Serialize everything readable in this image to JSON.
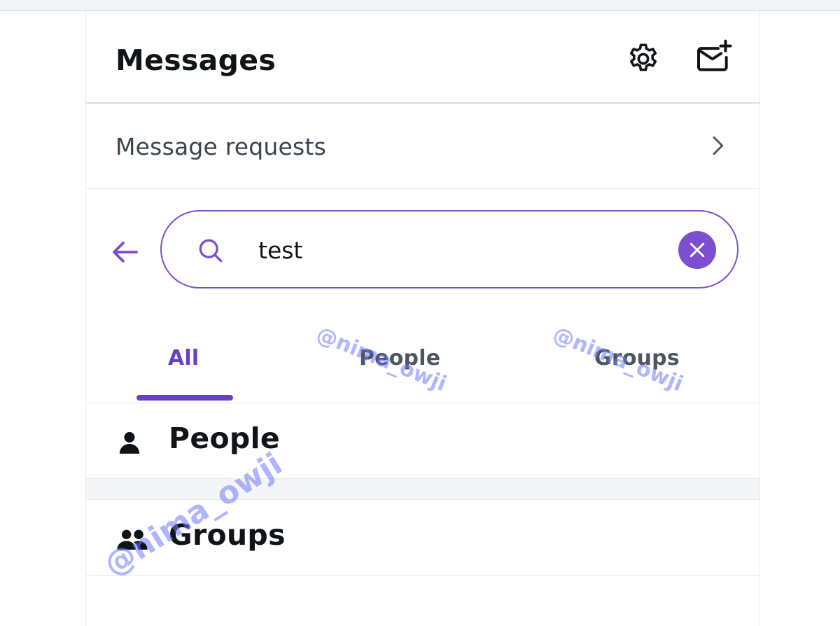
{
  "header": {
    "title": "Messages",
    "settings_icon": "gear-icon",
    "compose_icon": "new-message-icon"
  },
  "requests": {
    "label": "Message requests",
    "icon": "chevron-right-icon"
  },
  "search": {
    "value": "test",
    "placeholder": "",
    "back_icon": "arrow-left-icon",
    "search_icon": "search-icon",
    "clear_icon": "close-icon"
  },
  "tabs": [
    {
      "label": "All",
      "active": true
    },
    {
      "label": "People",
      "active": false
    },
    {
      "label": "Groups",
      "active": false
    }
  ],
  "sections": [
    {
      "label": "People",
      "icon": "person-icon"
    },
    {
      "label": "Groups",
      "icon": "people-icon"
    }
  ],
  "watermarks": [
    "@nima_owji",
    "@nima_owji",
    "@nima_owji"
  ],
  "colors": {
    "accent": "#7b4fd0",
    "tab_active": "#6b3fc4",
    "text_primary": "#0f1419",
    "text_secondary": "#4c5660"
  }
}
